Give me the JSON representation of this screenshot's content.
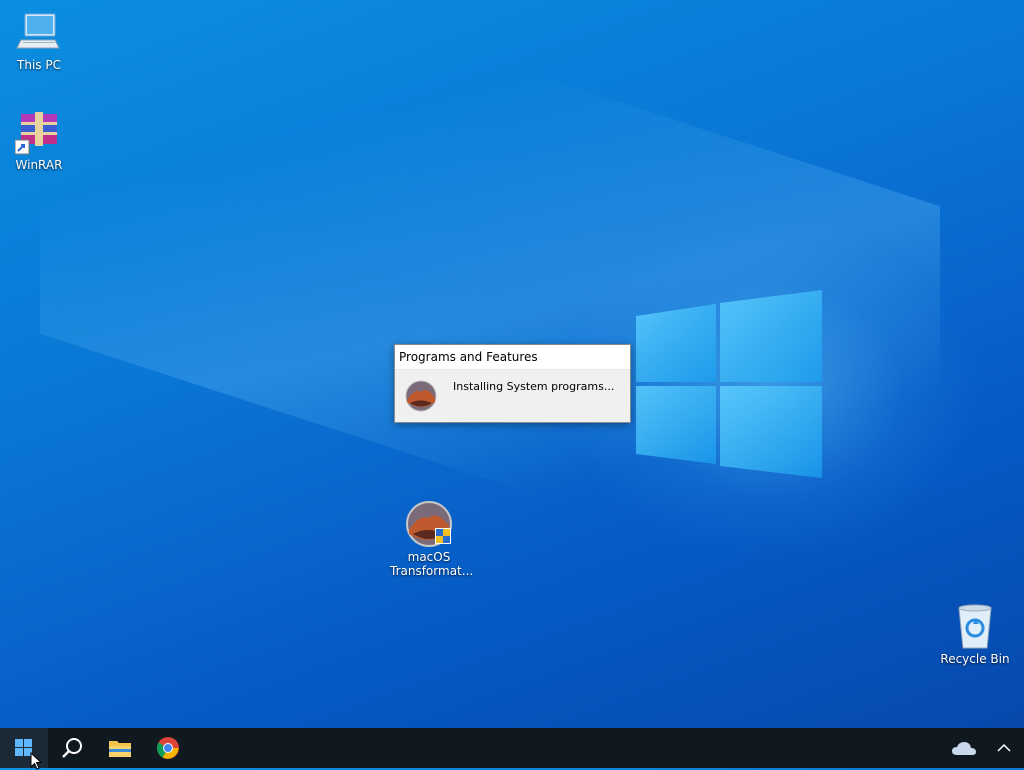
{
  "desktop": {
    "icons": [
      {
        "label": "This PC",
        "icon": "this-pc-icon"
      },
      {
        "label": "WinRAR",
        "icon": "winrar-icon"
      },
      {
        "label": "macOS Transformat...",
        "icon": "macos-transformation-icon"
      },
      {
        "label": "Recycle Bin",
        "icon": "recycle-bin-icon"
      }
    ]
  },
  "popup": {
    "title": "Programs and Features",
    "message": "Installing System programs...",
    "icon": "macos-icon"
  },
  "taskbar": {
    "start_icon": "windows-start-icon",
    "search_icon": "search-icon",
    "pinned": [
      {
        "name": "File Explorer",
        "icon": "file-explorer-icon"
      },
      {
        "name": "Google Chrome",
        "icon": "chrome-icon"
      }
    ],
    "tray": [
      {
        "name": "OneDrive",
        "icon": "onedrive-icon"
      },
      {
        "name": "Show hidden icons",
        "icon": "chevron-up-icon"
      }
    ]
  },
  "colors": {
    "desktop_blue": "#0a74d4",
    "taskbar": "#101820",
    "popup_body": "#f0f0f0"
  }
}
